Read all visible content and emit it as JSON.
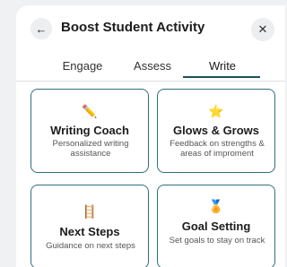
{
  "header": {
    "back_icon": "←",
    "title": "Boost Student Activity",
    "close_icon": "✕"
  },
  "tabs": [
    {
      "label": "Engage"
    },
    {
      "label": "Assess"
    },
    {
      "label": "Write",
      "active": true
    }
  ],
  "cards": [
    {
      "icon": "✏️",
      "icon_name": "pencil-icon",
      "title": "Writing Coach",
      "description": "Personalized writing assistance"
    },
    {
      "icon": "⭐",
      "icon_name": "star-icon",
      "title": "Glows & Grows",
      "description": "Feedback on strengths & areas of improment"
    },
    {
      "icon": "🪜",
      "icon_name": "ladder-icon",
      "title": "Next Steps",
      "description": "Guidance on next steps"
    },
    {
      "icon": "🏅",
      "icon_name": "medal-icon",
      "title": "Goal Setting",
      "description": "Set goals to stay on track"
    }
  ],
  "colors": {
    "accent": "#1f4f5c",
    "card_border": "#2f6f7d"
  }
}
